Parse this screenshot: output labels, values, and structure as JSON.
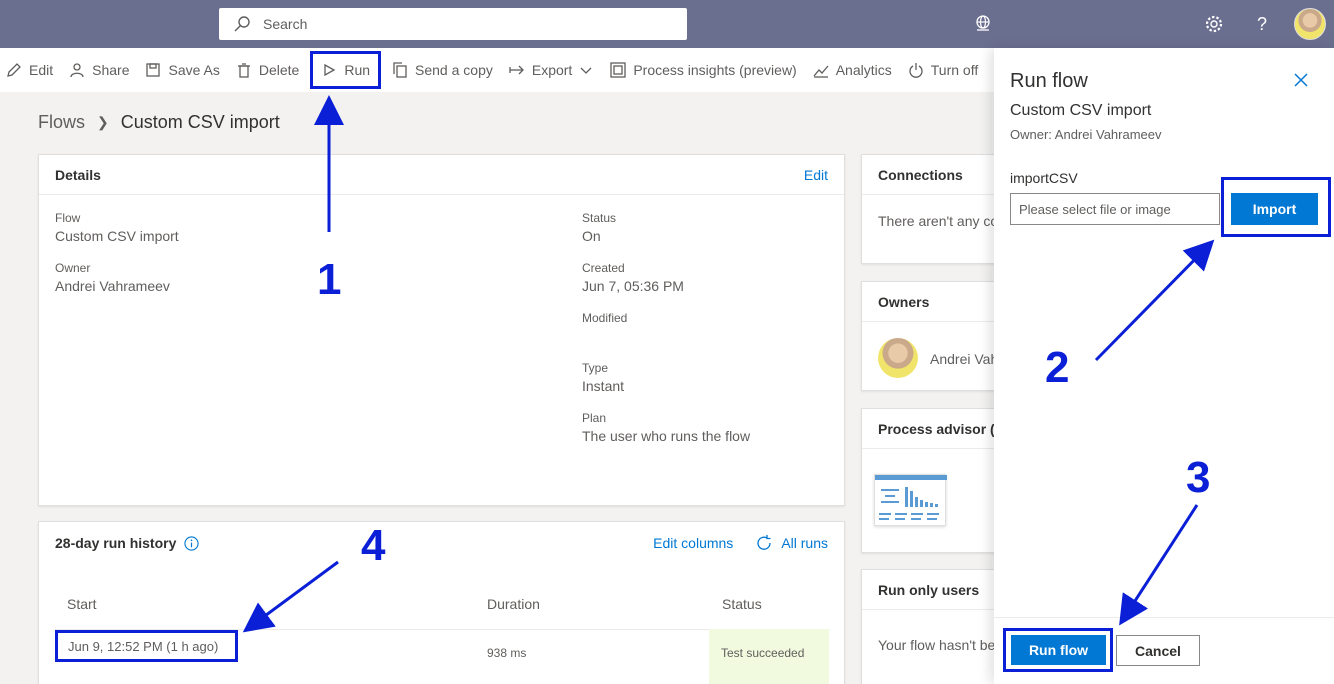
{
  "topbar": {
    "search_placeholder": "Search",
    "icons": [
      "search-icon",
      "environment-icon",
      "gear-icon",
      "help-icon",
      "avatar"
    ]
  },
  "commandbar": {
    "edit": "Edit",
    "share": "Share",
    "save_as": "Save As",
    "delete": "Delete",
    "run": "Run",
    "send_copy": "Send a copy",
    "export": "Export",
    "process_insights": "Process insights (preview)",
    "analytics": "Analytics",
    "turn_off": "Turn off"
  },
  "breadcrumb": {
    "root": "Flows",
    "current": "Custom CSV import"
  },
  "details": {
    "title": "Details",
    "edit_link": "Edit",
    "flow_label": "Flow",
    "flow_value": "Custom CSV import",
    "owner_label": "Owner",
    "owner_value": "Andrei Vahrameev",
    "status_label": "Status",
    "status_value": "On",
    "created_label": "Created",
    "created_value": "Jun 7, 05:36 PM",
    "modified_label": "Modified",
    "type_label": "Type",
    "type_value": "Instant",
    "plan_label": "Plan",
    "plan_value": "The user who runs the flow"
  },
  "run_history": {
    "title": "28-day run history",
    "edit_columns": "Edit columns",
    "all_runs": "All runs",
    "columns": [
      "Start",
      "Duration",
      "Status"
    ],
    "rows": [
      {
        "start": "Jun 9, 12:52 PM (1 h ago)",
        "duration": "938 ms",
        "status": "Test succeeded"
      }
    ]
  },
  "side_cards": {
    "connections_title": "Connections",
    "connections_text": "There aren't any co",
    "owners_title": "Owners",
    "owner_name": "Andrei Vah",
    "process_advisor_title": "Process advisor (p",
    "run_only_title": "Run only users",
    "run_only_text": "Your flow hasn't be"
  },
  "panel": {
    "title": "Run flow",
    "flow_name": "Custom CSV import",
    "owner": "Owner: Andrei Vahrameev",
    "input_label": "importCSV",
    "input_placeholder": "Please select file or image",
    "import_button": "Import",
    "run_button": "Run flow",
    "cancel_button": "Cancel"
  },
  "annotations": [
    "1",
    "2",
    "3",
    "4"
  ],
  "colors": {
    "annotation": "#0a1fd6",
    "primary": "#0078d4",
    "topbar": "#6b6f8f",
    "success_bg": "#f1fadf"
  }
}
